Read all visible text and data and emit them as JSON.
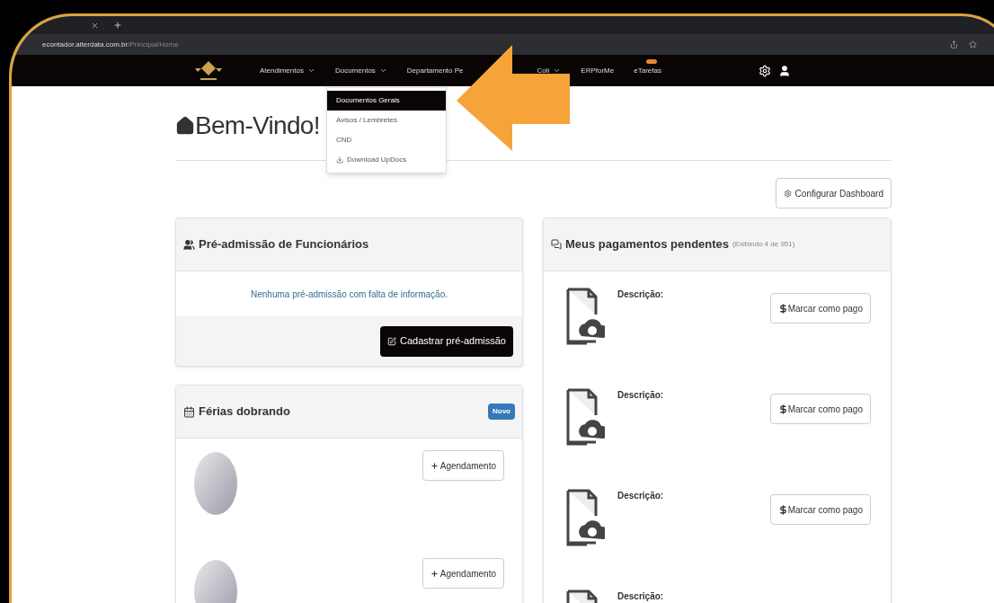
{
  "browser": {
    "url_host": "econtador.alterdata.com.br",
    "url_path": "/Principal/Home"
  },
  "nav": {
    "items": [
      {
        "label": "Atendimentos",
        "kind": "menu"
      },
      {
        "label": "Documentos",
        "kind": "menu"
      },
      {
        "label": "Departamento Pe",
        "kind": "covered"
      },
      {
        "label": "Coli",
        "kind": "menu"
      },
      {
        "label": "ERPforMe",
        "kind": "link"
      },
      {
        "label": "eTarefas",
        "kind": "badged"
      }
    ]
  },
  "dropdown": [
    {
      "label": "Documentos Gerais",
      "selected": true,
      "kind": "plain"
    },
    {
      "label": "Avisos / Lembretes",
      "selected": false,
      "kind": "plain"
    },
    {
      "label": "CND",
      "selected": false,
      "kind": "plain"
    },
    {
      "label": "Download UpDocs",
      "selected": false,
      "kind": "download"
    }
  ],
  "page": {
    "title": "Bem-Vindo!",
    "configure_button": "Configurar Dashboard"
  },
  "pre_admission": {
    "title": "Pré-admissão de Funcionários",
    "message": "Nenhuma pré-admissão com falta de informação.",
    "button": "Cadastrar pré-admissão"
  },
  "vacations": {
    "title": "Férias dobrando",
    "badge": "Novo",
    "rows": [
      {
        "button": "Agendamento"
      },
      {
        "button": "Agendamento"
      }
    ]
  },
  "payments": {
    "title": "Meus pagamentos pendentes",
    "subtitle": "(Exibindo 4 de 951)",
    "rows": [
      {
        "label": "Descrição:",
        "button": "Marcar como pago"
      },
      {
        "label": "Descrição:",
        "button": "Marcar como pago"
      },
      {
        "label": "Descrição:",
        "button": "Marcar como pago"
      },
      {
        "label": "Descrição:"
      }
    ]
  }
}
